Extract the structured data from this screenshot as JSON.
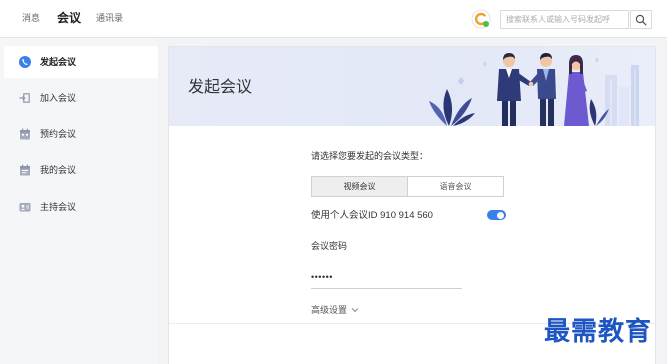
{
  "top_nav": {
    "tabs": [
      {
        "label": "消息",
        "active": false
      },
      {
        "label": "会议",
        "active": true
      },
      {
        "label": "通讯录",
        "active": false
      }
    ],
    "app_icon": "app-logo-icon",
    "search": {
      "placeholder": "搜索联系人或输入号码发起呼",
      "button_icon": "search-icon"
    }
  },
  "sidebar": {
    "items": [
      {
        "label": "发起会议",
        "icon": "phone-icon",
        "active": true
      },
      {
        "label": "加入会议",
        "icon": "join-door-icon",
        "active": false
      },
      {
        "label": "预约会议",
        "icon": "calendar-icon",
        "active": false
      },
      {
        "label": "我的会议",
        "icon": "calendar-list-icon",
        "active": false
      },
      {
        "label": "主持会议",
        "icon": "host-card-icon",
        "active": false
      }
    ]
  },
  "main": {
    "title": "发起会议",
    "prompt": "请选择您要发起的会议类型：",
    "meeting_types": [
      {
        "label": "视频会议",
        "selected": true
      },
      {
        "label": "语音会议",
        "selected": false
      }
    ],
    "personal_id": {
      "label": "使用个人会议ID 910 914 560",
      "enabled": true
    },
    "password": {
      "label": "会议密码",
      "value": "••••••"
    },
    "advanced": {
      "label": "高级设置",
      "icon": "chevron-down-icon"
    }
  },
  "watermark": "最需教育",
  "colors": {
    "accent": "#3a80e8",
    "watermark": "#1d56c2",
    "banner": "#e6eaf8"
  }
}
